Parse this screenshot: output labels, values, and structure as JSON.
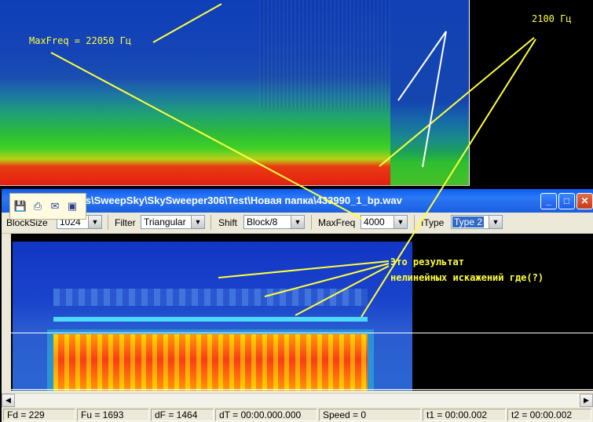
{
  "annotations": {
    "maxfreq_note": "MaxFreq = 22050 Гц",
    "freq_note": "2100 Гц",
    "distortion_line1": "Это результат",
    "distortion_line2": "нелинейных искажений где(?)"
  },
  "window": {
    "title": "files\\SweepSky\\SkySweeper306\\Test\\Новая папка\\433990_1_bp.wav",
    "buttons": {
      "minimize": "_",
      "maximize": "□",
      "close": "✕"
    }
  },
  "quick_access": {
    "icons": [
      "save-icon",
      "print-icon",
      "email-icon",
      "export-icon"
    ]
  },
  "toolbar": {
    "blocksize_label": "BlockSize",
    "blocksize_value": "1024",
    "filter_label": "Filter",
    "filter_value": "Triangular",
    "shift_label": "Shift",
    "shift_value": "Block/8",
    "maxfreq_label": "MaxFreq",
    "maxfreq_value": "4000",
    "itype_label": "IType",
    "itype_value": "Type 2"
  },
  "status": {
    "fd": "Fd = 229",
    "fu": "Fu = 1693",
    "df": "dF = 1464",
    "dt": "dT = 00:00.000.000",
    "speed": "Speed = 0",
    "t1": "t1 = 00:00.002",
    "t2": "t2 = 00:00.002"
  },
  "colors": {
    "annotation": "#ffff3c",
    "titlebar": "#0a5cf0",
    "window_face": "#ece9d8"
  }
}
